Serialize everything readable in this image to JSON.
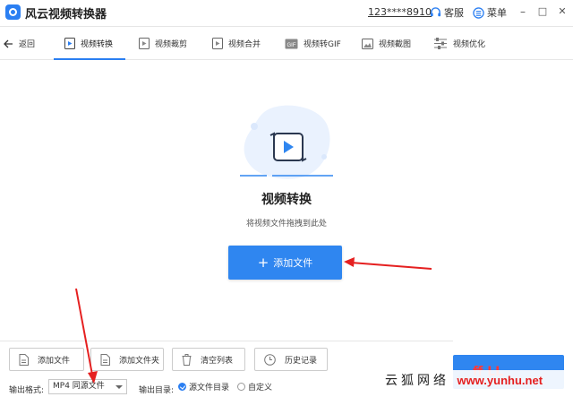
{
  "app": {
    "title": "风云视频转换器",
    "account": "123****8910",
    "service_label": "客服",
    "menu_label": "菜单",
    "window_controls": [
      "–",
      "□",
      "✕"
    ]
  },
  "nav": {
    "back_label": "返回",
    "tabs": [
      {
        "label": "视频转换",
        "icon": "video-convert-icon",
        "active": true
      },
      {
        "label": "视频裁剪",
        "icon": "video-crop-icon"
      },
      {
        "label": "视频合并",
        "icon": "video-merge-icon"
      },
      {
        "label": "视频转GIF",
        "icon": "gif-icon"
      },
      {
        "label": "视频截图",
        "icon": "screenshot-icon"
      },
      {
        "label": "视频优化",
        "icon": "optimize-icon"
      }
    ]
  },
  "main": {
    "title": "视频转换",
    "hint": "将视频文件拖拽到此处",
    "add_file_label": "添加文件"
  },
  "toolbar": {
    "add_file": "添加文件",
    "add_folder": "添加文件夹",
    "clear_list": "清空列表",
    "history": "历史记录"
  },
  "output": {
    "format_label": "输出格式:",
    "format_value": "MP4 同源文件",
    "dir_label": "输出目录:",
    "dir_options": [
      {
        "label": "源文件目录",
        "selected": true
      },
      {
        "label": "自定义",
        "selected": false
      }
    ]
  },
  "convert_button_partial": "ff LL",
  "watermark": {
    "text": "云狐网络",
    "domain": "www.yunhu.net"
  },
  "colors": {
    "accent": "#2f86f0",
    "annotation_arrow": "#e52020"
  }
}
